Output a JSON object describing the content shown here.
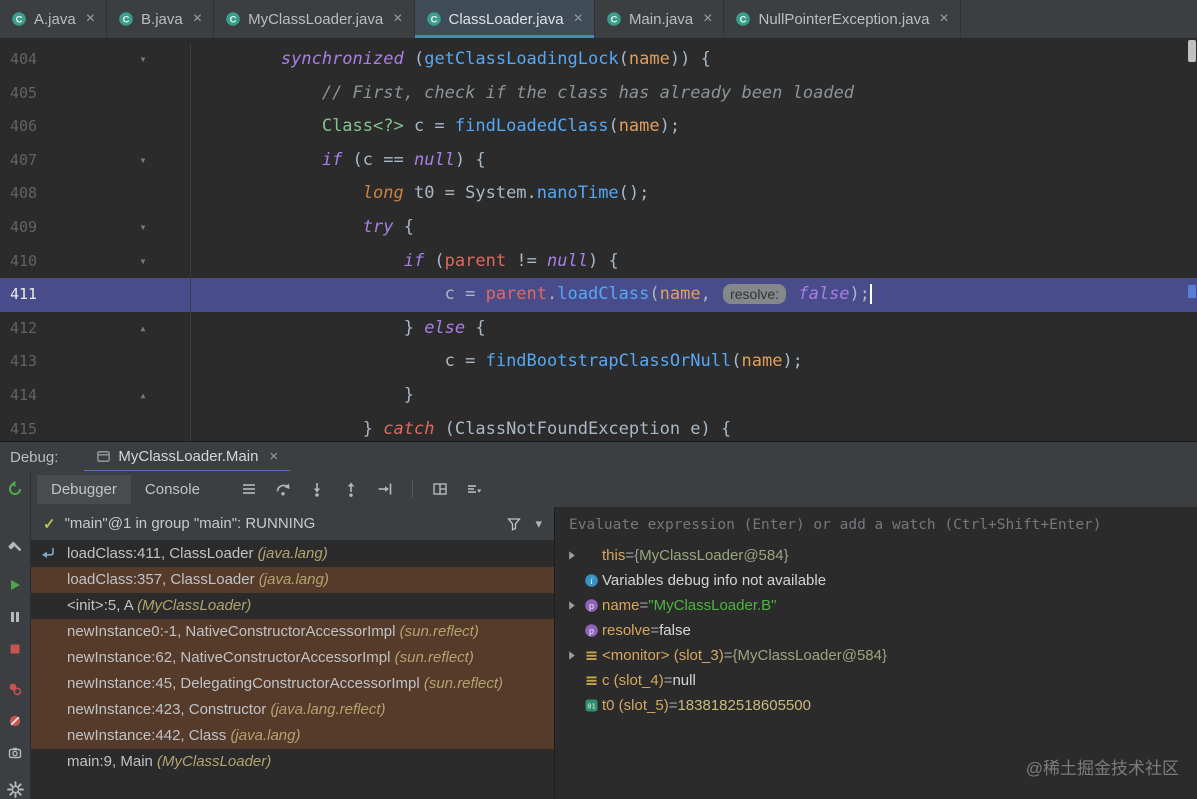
{
  "colors": {
    "accent_blue": "#4a88c7",
    "execution_line": "#484c8a",
    "library_frame_bg": "#563a2a",
    "panel_chrome": "#3c3f41",
    "editor_bg": "#2b2b2b",
    "breakpoint_red": "#c75450",
    "run_green": "#4ca54c"
  },
  "glyphs": {
    "close": "×",
    "check": "✓",
    "fold_down": "▾",
    "fold_up": "▴",
    "chevron_down": "▾",
    "eq": " = "
  },
  "editor_tabs": [
    {
      "label": "A.java",
      "active": false
    },
    {
      "label": "B.java",
      "active": false
    },
    {
      "label": "MyClassLoader.java",
      "active": false
    },
    {
      "label": "ClassLoader.java",
      "active": true
    },
    {
      "label": "Main.java",
      "active": false
    },
    {
      "label": "NullPointerException.java",
      "active": false
    }
  ],
  "editor": {
    "current_line": 411,
    "lines": [
      {
        "num": 404,
        "fold": "down",
        "tokens": [
          [
            "        ",
            "p"
          ],
          [
            "synchronized",
            "kw"
          ],
          [
            " (",
            "p"
          ],
          [
            "getClassLoadingLock",
            "m"
          ],
          [
            "(",
            "p"
          ],
          [
            "name",
            "prm"
          ],
          [
            ")) {",
            "p"
          ]
        ]
      },
      {
        "num": 405,
        "fold": "",
        "tokens": [
          [
            "            ",
            "p"
          ],
          [
            "// First, check if the class has already been loaded",
            "cm"
          ]
        ]
      },
      {
        "num": 406,
        "fold": "",
        "tokens": [
          [
            "            ",
            "p"
          ],
          [
            "Class<?> ",
            "ty"
          ],
          [
            "c = ",
            "p"
          ],
          [
            "findLoadedClass",
            "m"
          ],
          [
            "(",
            "p"
          ],
          [
            "name",
            "prm"
          ],
          [
            ");",
            "p"
          ]
        ]
      },
      {
        "num": 407,
        "fold": "down",
        "tokens": [
          [
            "            ",
            "p"
          ],
          [
            "if",
            "kw"
          ],
          [
            " (c == ",
            "p"
          ],
          [
            "null",
            "kw"
          ],
          [
            ") {",
            "p"
          ]
        ]
      },
      {
        "num": 408,
        "fold": "",
        "tokens": [
          [
            "                ",
            "p"
          ],
          [
            "long",
            "kw2"
          ],
          [
            " t0 = System.",
            "p"
          ],
          [
            "nanoTime",
            "m"
          ],
          [
            "();",
            "p"
          ]
        ]
      },
      {
        "num": 409,
        "fold": "down",
        "tokens": [
          [
            "                ",
            "p"
          ],
          [
            "try",
            "kw"
          ],
          [
            " {",
            "p"
          ]
        ]
      },
      {
        "num": 410,
        "fold": "down",
        "tokens": [
          [
            "                    ",
            "p"
          ],
          [
            "if",
            "kw"
          ],
          [
            " (",
            "p"
          ],
          [
            "parent",
            "fld"
          ],
          [
            " != ",
            "p"
          ],
          [
            "null",
            "kw"
          ],
          [
            ") {",
            "p"
          ]
        ]
      },
      {
        "num": 411,
        "fold": "",
        "tokens": [
          [
            "                        ",
            "p"
          ],
          [
            "c = ",
            "p"
          ],
          [
            "parent",
            "fld"
          ],
          [
            ".",
            "p"
          ],
          [
            "loadClass",
            "m"
          ],
          [
            "(",
            "p"
          ],
          [
            "name",
            "prm"
          ],
          [
            ", ",
            "p"
          ],
          [
            "resolve:",
            "hint"
          ],
          [
            " ",
            "p"
          ],
          [
            "false",
            "kw"
          ],
          [
            ");",
            "p"
          ],
          [
            "",
            "caret"
          ]
        ]
      },
      {
        "num": 412,
        "fold": "up",
        "tokens": [
          [
            "                    ",
            "p"
          ],
          [
            "} ",
            "p"
          ],
          [
            "else",
            "kw"
          ],
          [
            " {",
            "p"
          ]
        ]
      },
      {
        "num": 413,
        "fold": "",
        "tokens": [
          [
            "                        ",
            "p"
          ],
          [
            "c = ",
            "p"
          ],
          [
            "findBootstrapClassOrNull",
            "m"
          ],
          [
            "(",
            "p"
          ],
          [
            "name",
            "prm"
          ],
          [
            ");",
            "p"
          ]
        ]
      },
      {
        "num": 414,
        "fold": "up",
        "tokens": [
          [
            "                    ",
            "p"
          ],
          [
            "}",
            "p"
          ]
        ]
      },
      {
        "num": 415,
        "fold": "",
        "tokens": [
          [
            "                ",
            "p"
          ],
          [
            "} ",
            "p"
          ],
          [
            "catch",
            "kwc"
          ],
          [
            " (ClassNotFoundException e) {",
            "p"
          ]
        ]
      }
    ]
  },
  "debug_header": {
    "label": "Debug:",
    "session_tab": "MyClassLoader.Main"
  },
  "debug_tabs": [
    {
      "label": "Debugger",
      "active": true
    },
    {
      "label": "Console",
      "active": false
    }
  ],
  "debug_toolbar_icons": [
    "menu",
    "step-over",
    "step-into",
    "step-out",
    "run-to-cursor",
    "sep",
    "layout-grid",
    "view-options"
  ],
  "left_toolbar_icons": [
    "rerun",
    "build",
    "resume",
    "pause",
    "stop",
    "view-breakpoints",
    "mute-breakpoints",
    "thread-dump",
    "settings"
  ],
  "thread": {
    "status_text": "\"main\"@1 in group \"main\": RUNNING"
  },
  "frames": [
    {
      "text": "loadClass:411, ClassLoader ",
      "location": "(java.lang)",
      "library": false,
      "current": true
    },
    {
      "text": "loadClass:357, ClassLoader ",
      "location": "(java.lang)",
      "library": true,
      "current": false
    },
    {
      "text": "<init>:5, A ",
      "location": "(MyClassLoader)",
      "library": false,
      "current": false
    },
    {
      "text": "newInstance0:-1, NativeConstructorAccessorImpl ",
      "location": "(sun.reflect)",
      "library": true,
      "current": false
    },
    {
      "text": "newInstance:62, NativeConstructorAccessorImpl ",
      "location": "(sun.reflect)",
      "library": true,
      "current": false
    },
    {
      "text": "newInstance:45, DelegatingConstructorAccessorImpl ",
      "location": "(sun.reflect)",
      "library": true,
      "current": false
    },
    {
      "text": "newInstance:423, Constructor ",
      "location": "(java.lang.reflect)",
      "library": true,
      "current": false
    },
    {
      "text": "newInstance:442, Class ",
      "location": "(java.lang)",
      "library": true,
      "current": false
    },
    {
      "text": "main:9, Main ",
      "location": "(MyClassLoader)",
      "library": false,
      "current": false
    }
  ],
  "variables": {
    "evaluate_placeholder": "Evaluate expression (Enter) or add a watch (Ctrl+Shift+Enter)",
    "items": [
      {
        "kind": "var",
        "expand": true,
        "icon": "none",
        "name": "this",
        "value": "{MyClassLoader@584}",
        "vtype": "ref"
      },
      {
        "kind": "info",
        "text": "Variables debug info not available"
      },
      {
        "kind": "var",
        "expand": true,
        "icon": "param",
        "name": "name",
        "value": "\"MyClassLoader.B\"",
        "vtype": "string"
      },
      {
        "kind": "var",
        "expand": false,
        "icon": "param",
        "name": "resolve",
        "value": "false",
        "vtype": "plain"
      },
      {
        "kind": "var",
        "expand": true,
        "icon": "field",
        "name": "<monitor> (slot_3)",
        "value": "{MyClassLoader@584}",
        "vtype": "ref"
      },
      {
        "kind": "var",
        "expand": false,
        "icon": "field",
        "name": "c (slot_4)",
        "value": "null",
        "vtype": "plain"
      },
      {
        "kind": "var",
        "expand": false,
        "icon": "primitive",
        "name": "t0 (slot_5)",
        "value": "1838182518605500",
        "vtype": "number"
      }
    ]
  },
  "watermark": "@稀土掘金技术社区"
}
